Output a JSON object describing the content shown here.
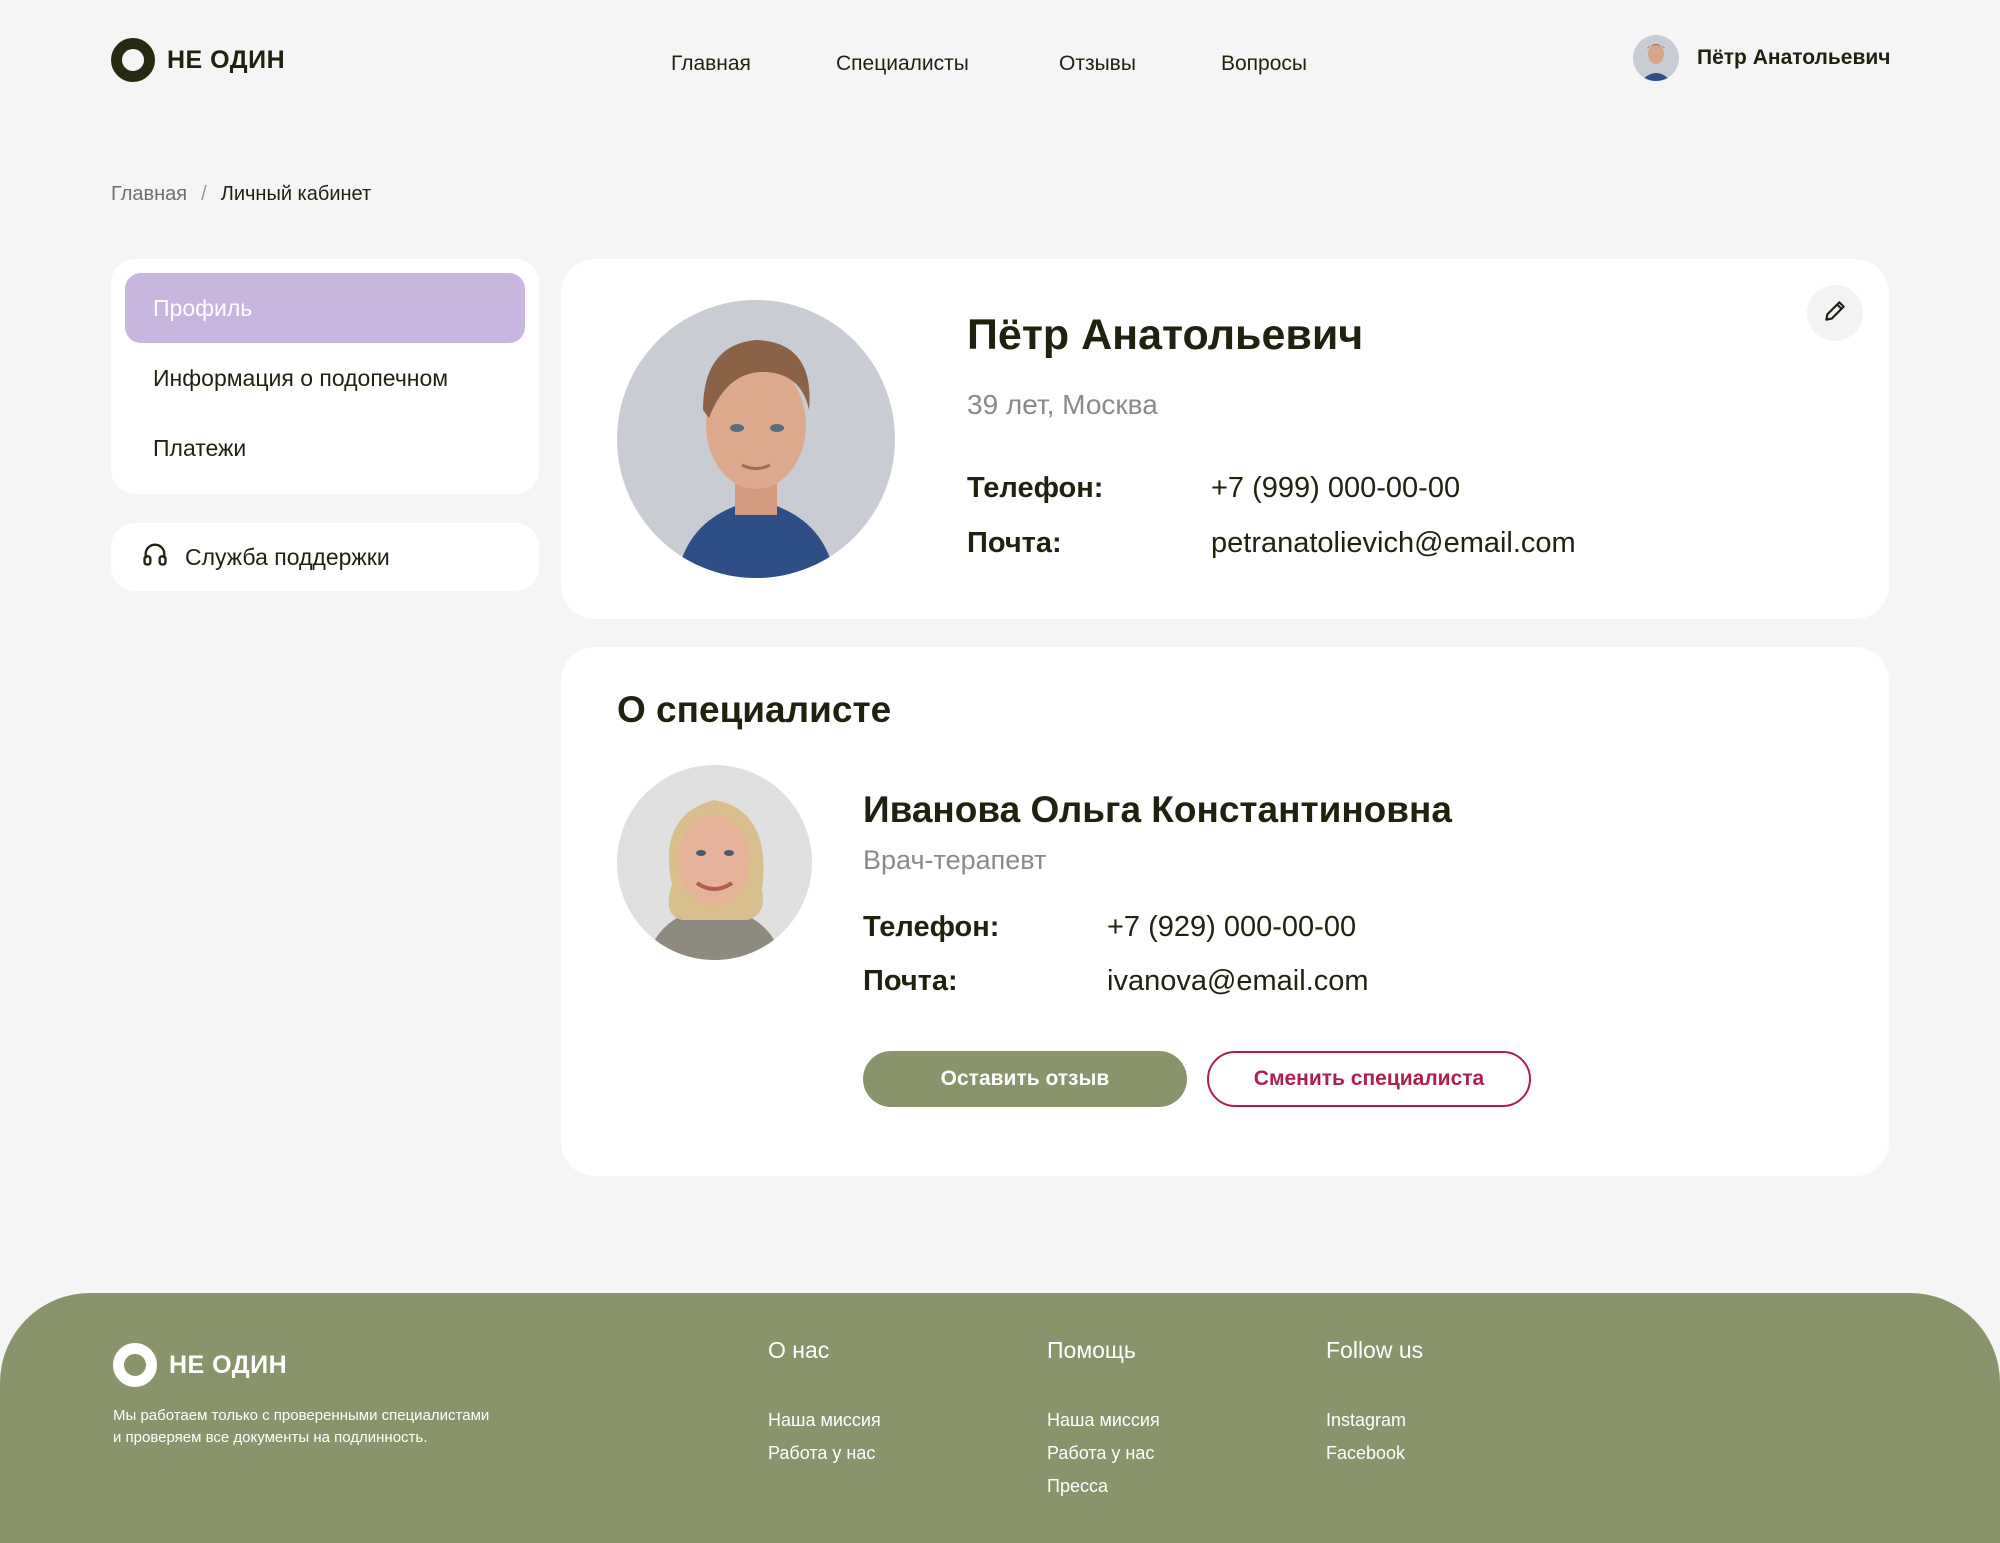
{
  "header": {
    "logo_text": "НЕ ОДИН",
    "nav": [
      "Главная",
      "Специалисты",
      "Отзывы",
      "Вопросы"
    ],
    "user_name": "Пётр Анатольевич"
  },
  "breadcrumb": {
    "home": "Главная",
    "separator": "/",
    "current": "Личный кабинет"
  },
  "sidebar": {
    "items": [
      {
        "label": "Профиль",
        "active": true
      },
      {
        "label": "Информация о подопечном",
        "active": false
      },
      {
        "label": "Платежи",
        "active": false
      }
    ],
    "support_label": "Служба поддержки",
    "support_icon": "headphones-icon"
  },
  "profile": {
    "name": "Пётр Анатольевич",
    "subtitle": "39 лет, Москва",
    "phone_label": "Телефон:",
    "phone": "+7 (999) 000-00-00",
    "email_label": "Почта:",
    "email": "petranatolievich@email.com",
    "edit_icon": "pencil-icon"
  },
  "specialist": {
    "section_title": "О специалисте",
    "name": "Иванова Ольга Константиновна",
    "role": "Врач-терапевт",
    "phone_label": "Телефон:",
    "phone": "+7 (929) 000-00-00",
    "email_label": "Почта:",
    "email": "ivanova@email.com",
    "review_button": "Оставить отзыв",
    "change_button": "Сменить специалиста"
  },
  "footer": {
    "logo_text": "НЕ ОДИН",
    "description": "Мы работаем только с проверенными специалистами и проверяем все документы на подлинность.",
    "columns": [
      {
        "title": "О нас",
        "links": [
          "Наша миссия",
          "Работа у нас"
        ]
      },
      {
        "title": "Помощь",
        "links": [
          "Наша миссия",
          "Работа у нас",
          "Пресса"
        ]
      },
      {
        "title": "Follow us",
        "links": [
          "Instagram",
          "Facebook"
        ]
      }
    ]
  },
  "colors": {
    "accent_purple": "#c8b6e0",
    "olive": "#8a946a",
    "crimson": "#b01f4a",
    "dark": "#1e2310"
  }
}
